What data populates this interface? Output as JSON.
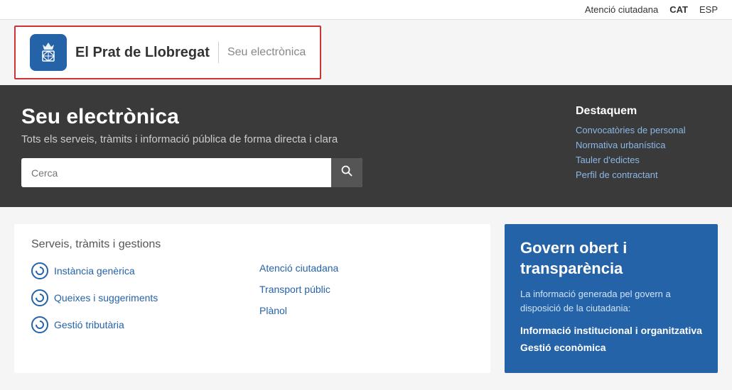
{
  "topnav": {
    "atencio": "Atenció ciutadana",
    "cat": "CAT",
    "esp": "ESP"
  },
  "header": {
    "city": "El Prat de Llobregat",
    "subtitle": "Seu electrònica"
  },
  "hero": {
    "title": "Seu electrònica",
    "subtitle": "Tots els serveis, tràmits i informació pública de forma directa i clara",
    "search_placeholder": "Cerca"
  },
  "destaquem": {
    "heading": "Destaquem",
    "links": [
      "Convocatòries de personal",
      "Normativa urbanística",
      "Tauler d'edictes",
      "Perfil de contractant"
    ]
  },
  "services": {
    "heading": "Serveis, tràmits i gestions",
    "left_items": [
      "Instància genèrica",
      "Queixes i suggeriments",
      "Gestió tributària"
    ],
    "right_items": [
      "Atenció ciutadana",
      "Transport públic",
      "Plànol"
    ]
  },
  "govern": {
    "title": "Govern obert i transparència",
    "description": "La informació generada pel govern a disposició de la ciutadania:",
    "links": [
      "Informació institucional i organitzativa",
      "Gestió econòmica"
    ]
  }
}
